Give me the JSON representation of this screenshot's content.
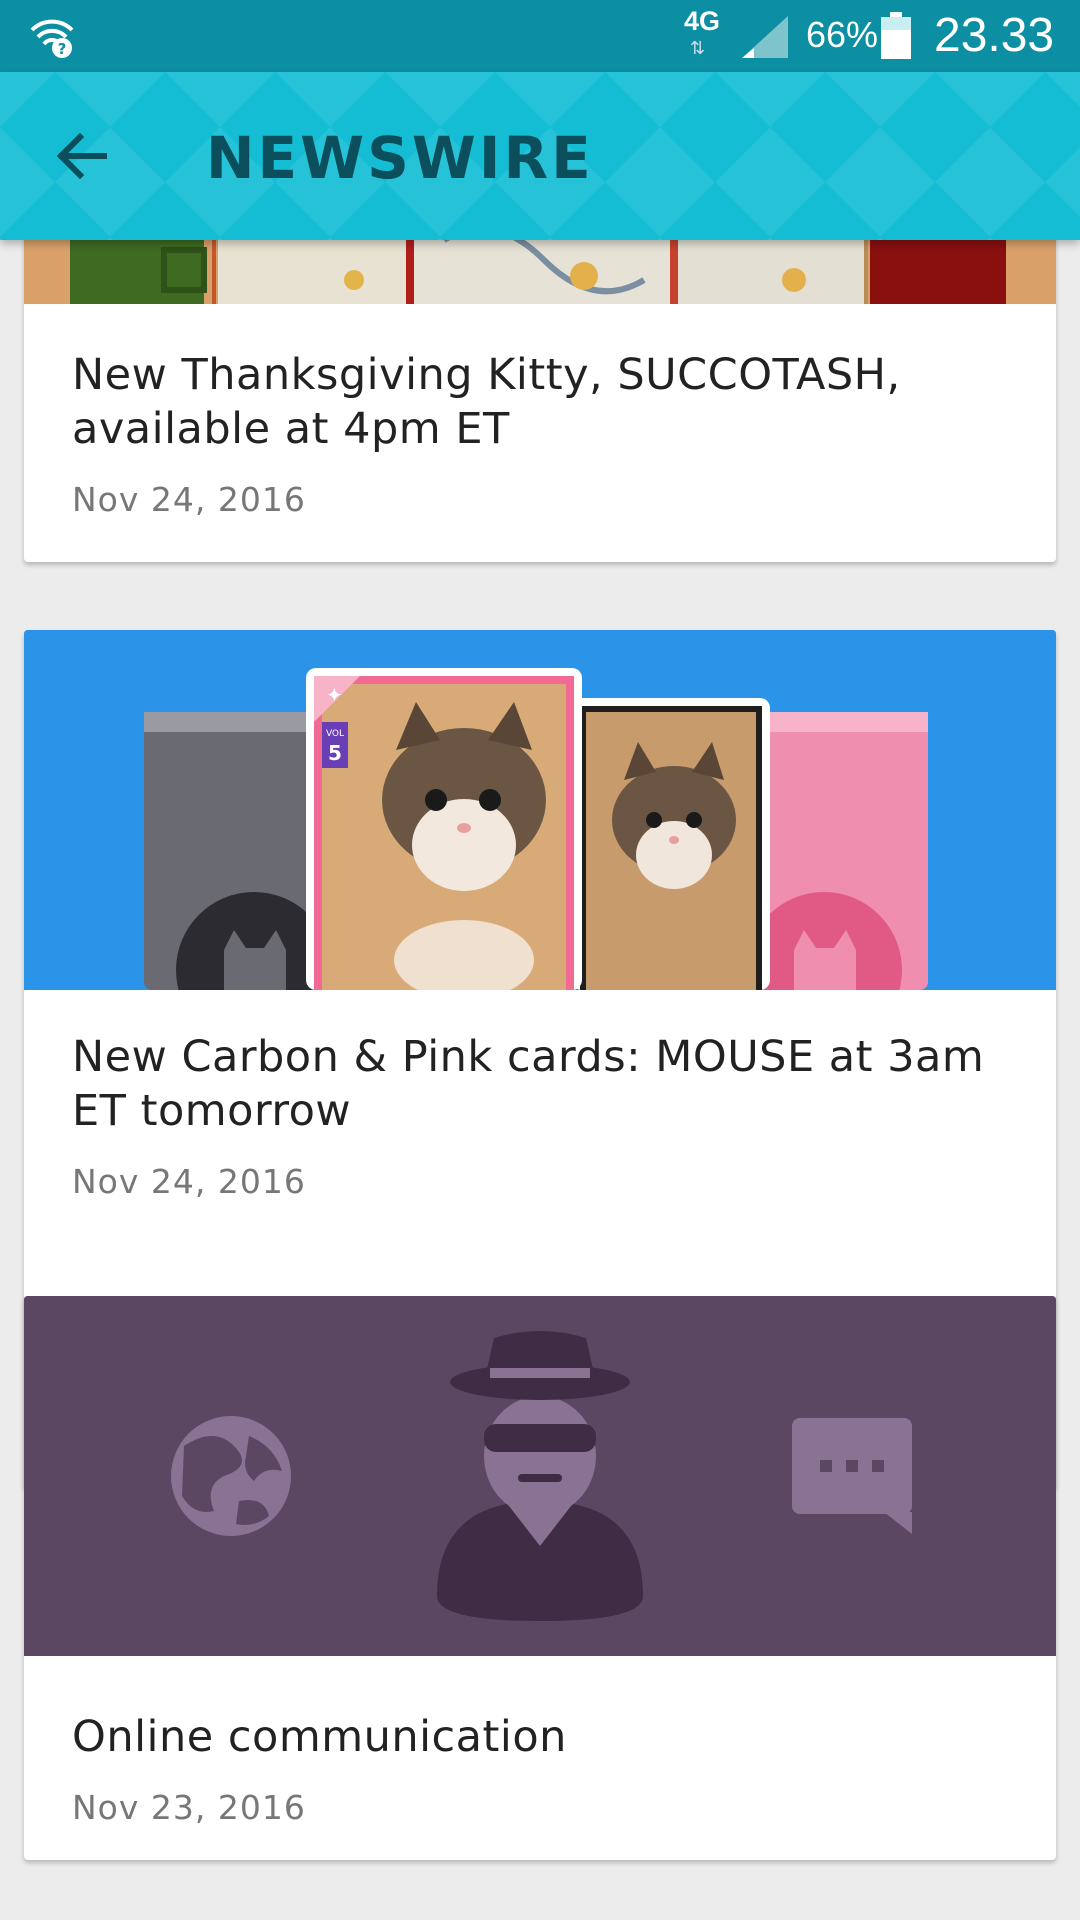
{
  "status_bar": {
    "network": "4G",
    "battery": "66%",
    "time": "23.33"
  },
  "app_bar": {
    "title": "NEWSWIRE"
  },
  "feed": [
    {
      "headline": "New Thanksgiving Kitty, SUCCOTASH, available at 4pm ET",
      "date": "Nov 24, 2016"
    },
    {
      "headline": "New Carbon & Pink cards: MOUSE at 3am ET tomorrow",
      "date": "Nov 24, 2016",
      "badge_label": "VOL",
      "badge_number": "5"
    },
    {
      "headline": "Online communication",
      "date": "Nov 23, 2016"
    }
  ],
  "colors": {
    "status_bar": "#0d8fa3",
    "app_bar": "#15bdd4",
    "title": "#0b4f5c",
    "card2_banner": "#2b93e8",
    "card3_banner": "#5c4763"
  }
}
